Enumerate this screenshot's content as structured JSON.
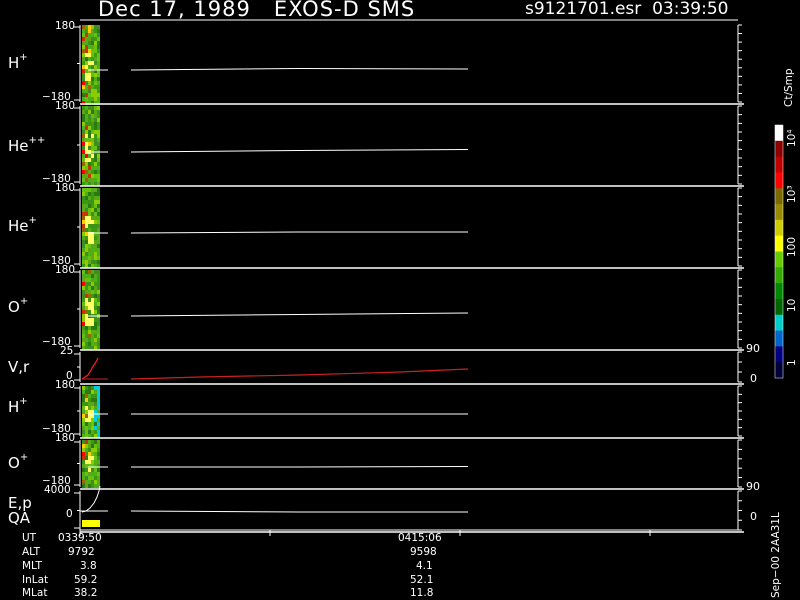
{
  "header": {
    "date": "Dec 17, 1989",
    "instrument": "EXOS-D SMS",
    "filename": "s9121701.esr",
    "time": "03:39:50"
  },
  "panels": [
    {
      "label": "H",
      "sup": "+",
      "ymax": "180",
      "ymin": "−180"
    },
    {
      "label": "He",
      "sup": "++",
      "ymax": "180",
      "ymin": "−180"
    },
    {
      "label": "He",
      "sup": "+",
      "ymax": "180",
      "ymin": "−180"
    },
    {
      "label": "O",
      "sup": "+",
      "ymax": "180",
      "ymin": "−180"
    },
    {
      "label": "V,r",
      "sup": "",
      "ymax": "25",
      "ymin": "0"
    },
    {
      "label": "H",
      "sup": "+",
      "ymax": "180",
      "ymin": "−180"
    },
    {
      "label": "O",
      "sup": "+",
      "ymax": "180",
      "ymin": "−180"
    },
    {
      "label": "E,p",
      "sup": "",
      "ymax": "4000",
      "ymin": "0"
    }
  ],
  "qa_label": "QA",
  "right_axes": {
    "vr": {
      "top": "90",
      "bottom": "0"
    },
    "ep": {
      "top": "90",
      "bottom": "0"
    }
  },
  "colorbar": {
    "unit": "Ct/Smp",
    "ticks": [
      "10⁴",
      "10³",
      "100",
      "10",
      "1"
    ],
    "colors": [
      "#ffffff",
      "#8b0000",
      "#c00000",
      "#ff0000",
      "#7a6a00",
      "#9a8a00",
      "#cccc00",
      "#ffff00",
      "#66cc00",
      "#33aa00",
      "#008800",
      "#006600",
      "#00cccc",
      "#0066cc",
      "#000080",
      "#00003a"
    ]
  },
  "footer": {
    "rows": [
      {
        "name": "UT",
        "start": "0339:50",
        "mid": "0415:06"
      },
      {
        "name": "ALT",
        "start": "9792",
        "mid": "9598"
      },
      {
        "name": "MLT",
        "start": "3.8",
        "mid": "4.1"
      },
      {
        "name": "InLat",
        "start": "59.2",
        "mid": "52.1"
      },
      {
        "name": "MLat",
        "start": "38.2",
        "mid": "11.8"
      }
    ],
    "version": "Sep−00 2AA31L"
  },
  "chart_data": {
    "type": "heatmap",
    "title": "Dec 17, 1989   EXOS-D SMS",
    "x_ticks": [
      "0339:50",
      "0415:06"
    ],
    "colorbar_ticks": [
      "1",
      "10",
      "100",
      "10³",
      "10⁴"
    ],
    "colorbar_unit": "Ct/Smp",
    "series": [
      {
        "name": "H+",
        "ylim": [
          -180,
          180
        ]
      },
      {
        "name": "He++",
        "ylim": [
          -180,
          180
        ]
      },
      {
        "name": "He+",
        "ylim": [
          -180,
          180
        ]
      },
      {
        "name": "O+",
        "ylim": [
          -180,
          180
        ]
      },
      {
        "name": "V,r",
        "ylim": [
          0,
          25
        ],
        "right_ylim": [
          0,
          90
        ]
      },
      {
        "name": "H+",
        "ylim": [
          -180,
          180
        ]
      },
      {
        "name": "O+",
        "ylim": [
          -180,
          180
        ]
      },
      {
        "name": "E,p",
        "ylim": [
          0,
          4000
        ],
        "right_ylim": [
          0,
          90
        ]
      }
    ]
  }
}
